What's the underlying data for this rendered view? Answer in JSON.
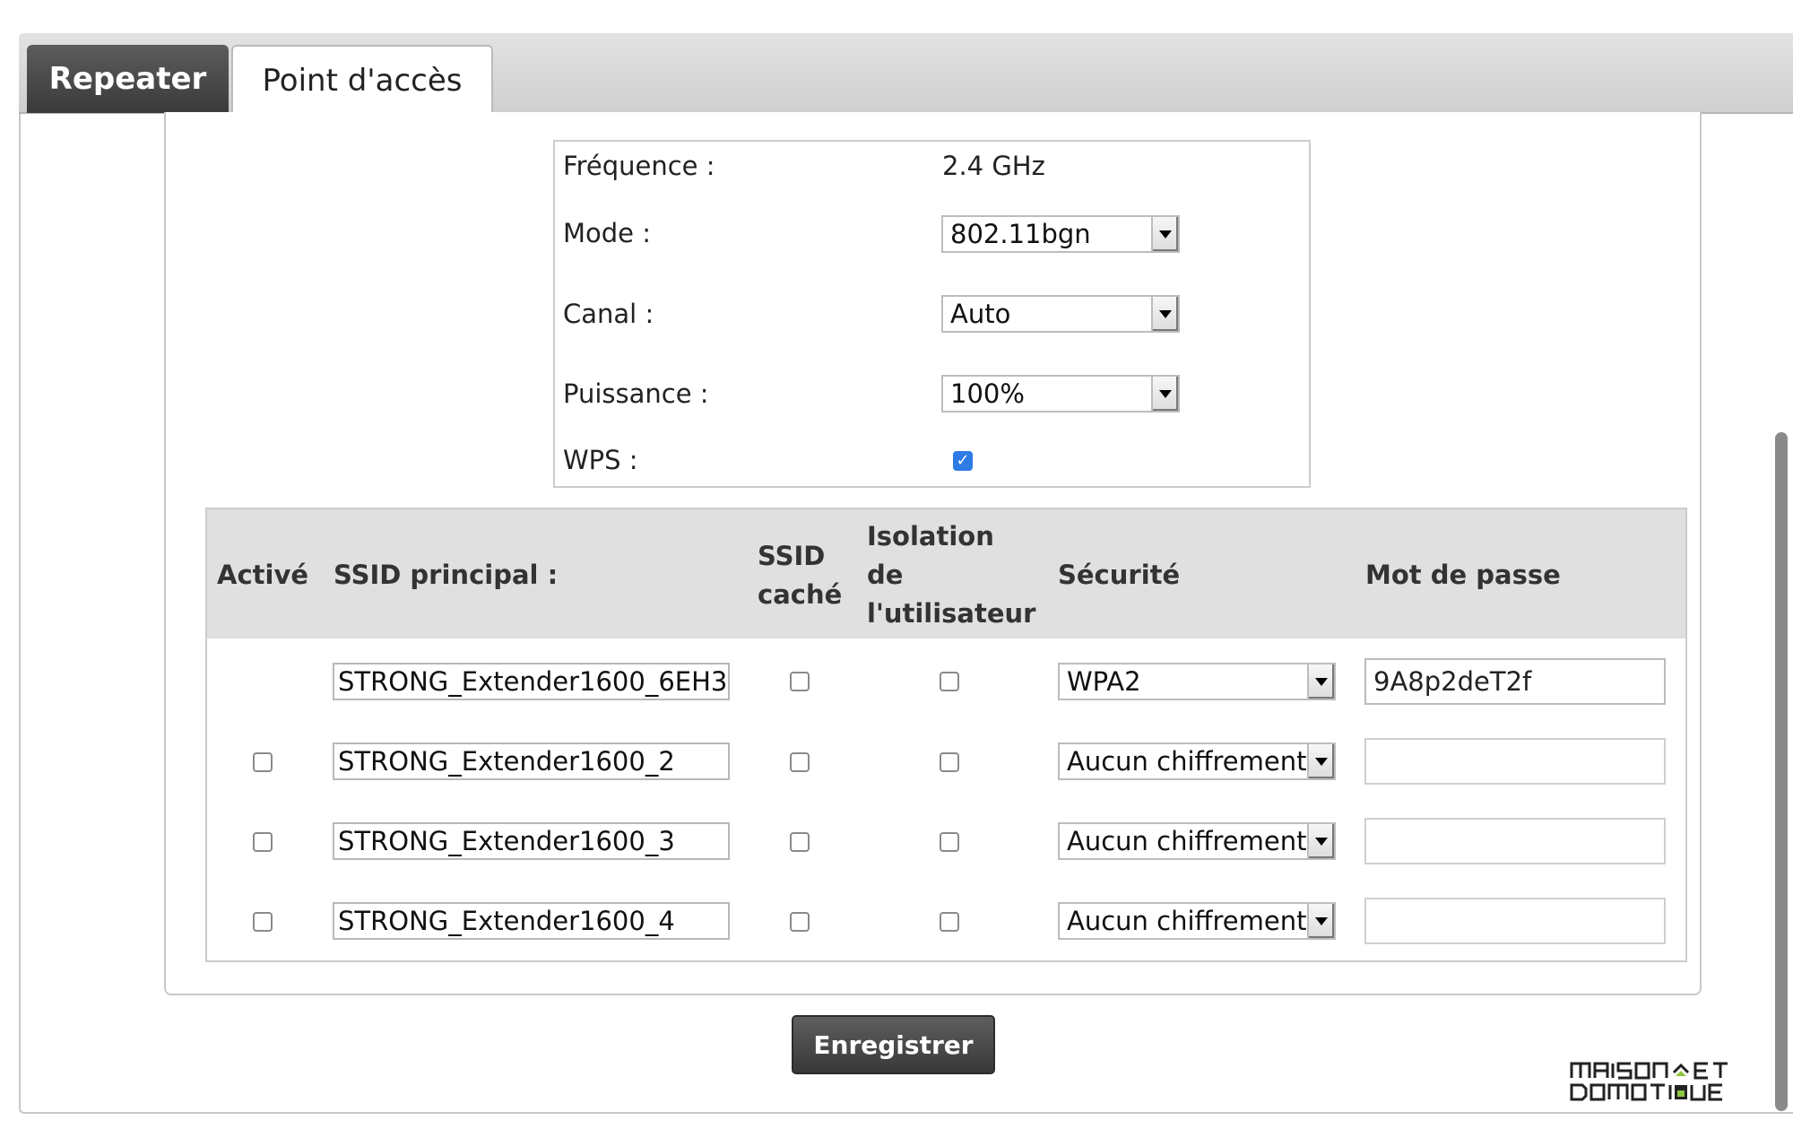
{
  "tabs": [
    {
      "label": "Repeater",
      "active": false
    },
    {
      "label": "Point d'accès",
      "active": true
    }
  ],
  "radio": {
    "frequency_label": "Fréquence :",
    "frequency_value": "2.4 GHz",
    "mode_label": "Mode :",
    "mode_value": "802.11bgn",
    "channel_label": "Canal :",
    "channel_value": "Auto",
    "power_label": "Puissance :",
    "power_value": "100%",
    "wps_label": "WPS :",
    "wps_checked": true
  },
  "ssid_table": {
    "headers": {
      "active": "Activé",
      "ssid": "SSID principal :",
      "hidden_1": "SSID",
      "hidden_2": "caché",
      "isolation_1": "Isolation",
      "isolation_2": "de",
      "isolation_3": "l'utilisateur",
      "security": "Sécurité",
      "password": "Mot de passe"
    },
    "rows": [
      {
        "active_checkbox": false,
        "ssid": "STRONG_Extender1600_6EH3",
        "hidden": false,
        "isolation": false,
        "security": "WPA2",
        "password": "9A8p2deT2f"
      },
      {
        "active_checkbox": true,
        "active": false,
        "ssid": "STRONG_Extender1600_2",
        "hidden": false,
        "isolation": false,
        "security": "Aucun chiffrement",
        "password": ""
      },
      {
        "active_checkbox": true,
        "active": false,
        "ssid": "STRONG_Extender1600_3",
        "hidden": false,
        "isolation": false,
        "security": "Aucun chiffrement",
        "password": ""
      },
      {
        "active_checkbox": true,
        "active": false,
        "ssid": "STRONG_Extender1600_4",
        "hidden": false,
        "isolation": false,
        "security": "Aucun chiffrement",
        "password": ""
      }
    ]
  },
  "save_button": "Enregistrer",
  "watermark": {
    "line1": "MAISON ET",
    "line2": "DOMOTIQUE"
  },
  "icons": {
    "select_arrow": "chevron-down-icon",
    "check": "checkmark-icon"
  }
}
